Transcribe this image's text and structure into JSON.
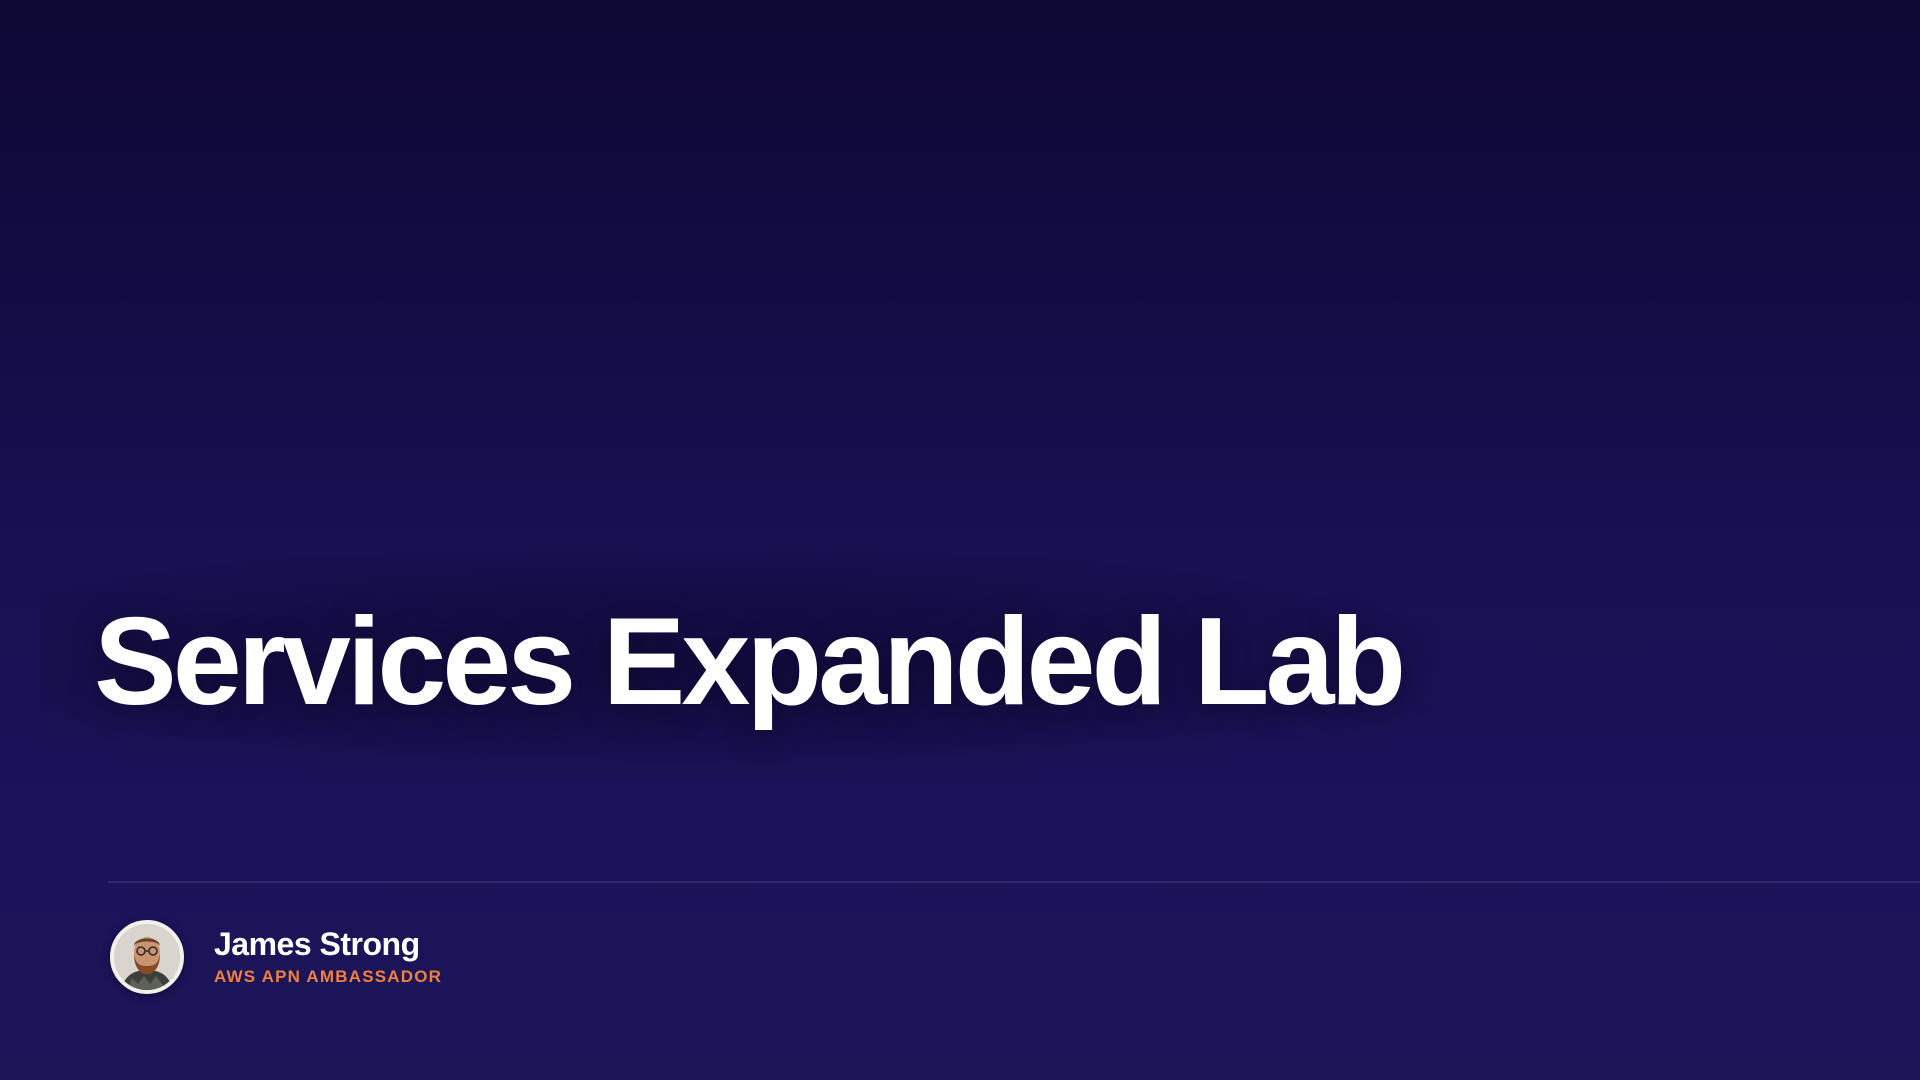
{
  "slide": {
    "title": "Services Expanded Lab"
  },
  "presenter": {
    "name": "James Strong",
    "role": "AWS APN AMBASSADOR"
  },
  "colors": {
    "background_top": "#0e0834",
    "background_bottom": "#1b1457",
    "title": "#ffffff",
    "role_accent": "#f0803c",
    "divider": "#2e2872"
  }
}
